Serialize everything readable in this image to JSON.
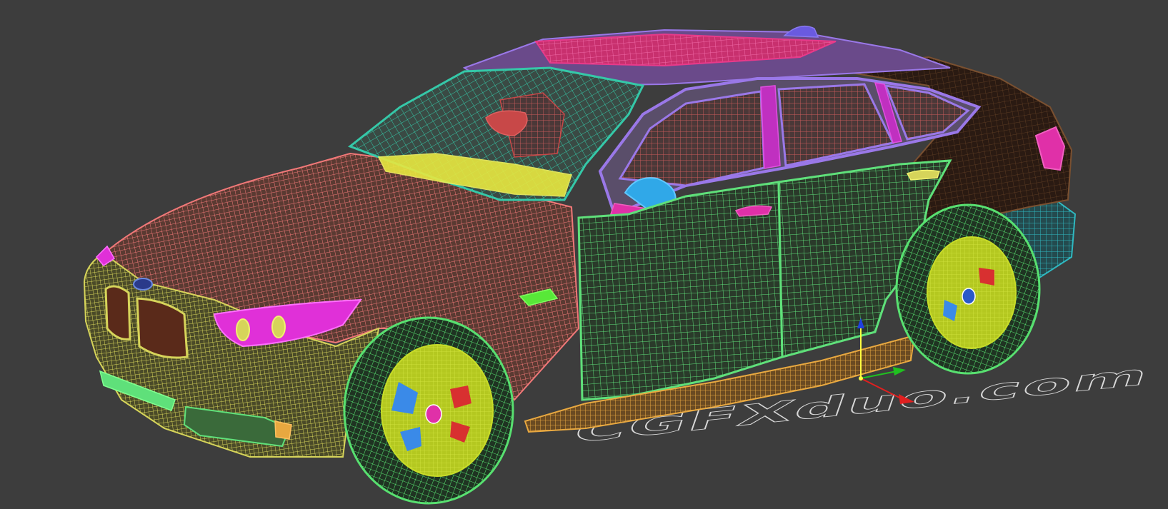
{
  "viewport": {
    "background": "#3d3d3d",
    "watermark_text": "CGFXduo.com"
  },
  "palette": {
    "body_pink": "#f07878",
    "door_green": "#5fe07a",
    "bumper_yellow": "#d6d45a",
    "wheel_green": "#58e070",
    "rim_yellow": "#c8dc28",
    "roof_magenta": "#e83a8a",
    "window_teal": "#35c8a8",
    "window_trim_violet": "#9a78e8",
    "rear_dark": "#3a2418",
    "rear_teal": "#2fb8c0",
    "sill_orange": "#e8a840",
    "interior_red": "#c84848",
    "dashboard_yellow": "#e8e840",
    "light_magenta": "#e030d8",
    "grille_brown": "#5a2a1a",
    "mirror_cyan": "#30a8e8",
    "gizmo_x": "#e02020",
    "gizmo_y": "#20c020",
    "gizmo_z": "#2040e0"
  },
  "gizmo": {
    "axes": [
      "x-axis",
      "y-axis",
      "z-axis"
    ]
  }
}
